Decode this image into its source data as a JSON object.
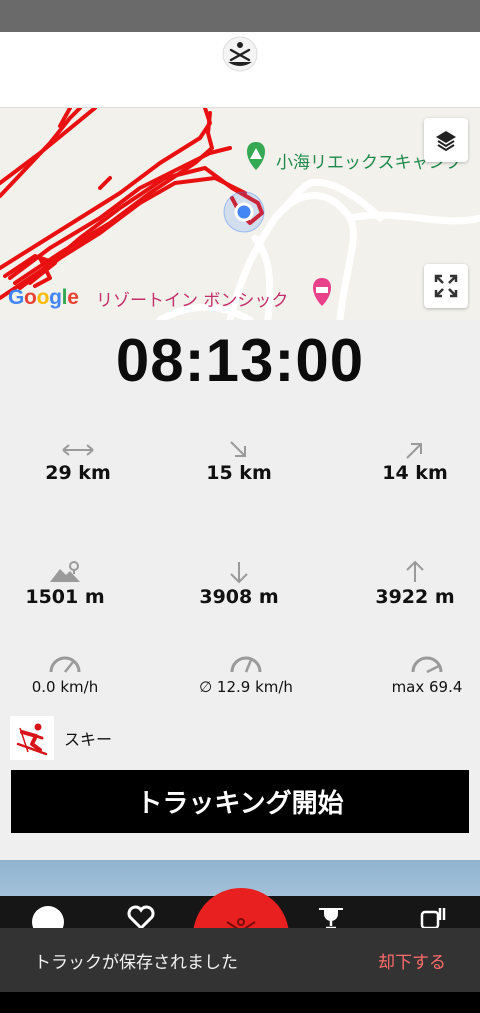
{
  "map": {
    "poi_campground": "小海リエックスキャンプ",
    "poi_hotel": "リゾートイン ボンシック",
    "google_logo": "Google"
  },
  "timer": "08:13:00",
  "stats": {
    "distance": "29 km",
    "downhill_distance": "15 km",
    "uphill_distance": "14 km",
    "altitude": "1501 m",
    "descent": "3908 m",
    "ascent": "3922 m",
    "current_speed": "0.0 km/h",
    "avg_speed": "∅ 12.9 km/h",
    "max_speed": "max 69.4"
  },
  "activity": {
    "label": "スキー",
    "icon": "skier-icon"
  },
  "start_button": "トラッキング開始",
  "snackbar": {
    "message": "トラックが保存されました",
    "action": "却下する"
  },
  "colors": {
    "track": "#e81010",
    "accent_red": "#e8201f",
    "snackbar_bg": "#333333",
    "snackbar_action": "#ff6b6b"
  }
}
